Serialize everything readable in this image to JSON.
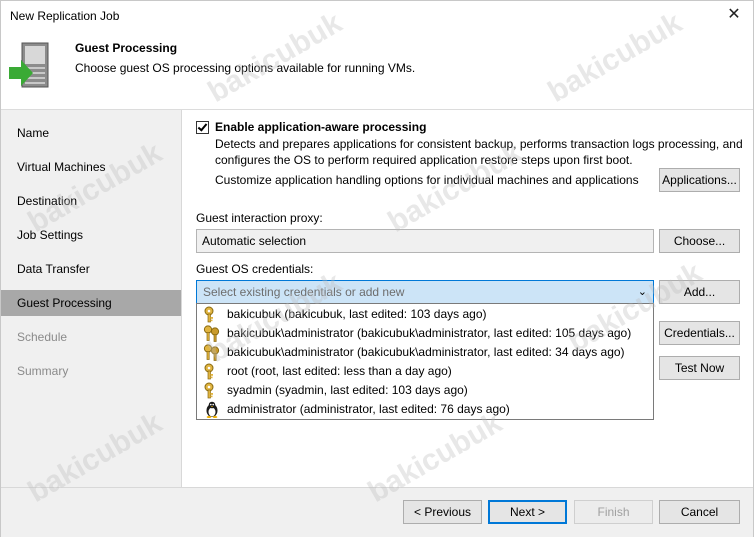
{
  "window": {
    "title": "New Replication Job",
    "close_glyph": "✕"
  },
  "header": {
    "title": "Guest Processing",
    "description": "Choose guest OS processing options available for running VMs.",
    "icon": "vm-arrow-icon"
  },
  "sidebar": {
    "items": [
      {
        "label": "Name",
        "state": "normal"
      },
      {
        "label": "Virtual Machines",
        "state": "normal"
      },
      {
        "label": "Destination",
        "state": "normal"
      },
      {
        "label": "Job Settings",
        "state": "normal"
      },
      {
        "label": "Data Transfer",
        "state": "normal"
      },
      {
        "label": "Guest Processing",
        "state": "active"
      },
      {
        "label": "Schedule",
        "state": "disabled"
      },
      {
        "label": "Summary",
        "state": "disabled"
      }
    ]
  },
  "main": {
    "app_aware": {
      "checked": true,
      "label": "Enable application-aware processing",
      "description_line1": "Detects and prepares applications for consistent backup, performs transaction logs processing, and",
      "description_line2": "configures the OS to perform required application restore steps upon first boot.",
      "customize_text": "Customize application handling options for individual machines and applications",
      "applications_button": "Applications..."
    },
    "proxy": {
      "label": "Guest interaction proxy:",
      "value": "Automatic selection",
      "choose_button": "Choose..."
    },
    "credentials": {
      "label": "Guest OS credentials:",
      "placeholder": "Select existing credentials or add new",
      "add_button": "Add...",
      "credentials_button": "Credentials...",
      "test_button": "Test Now",
      "options": [
        {
          "text": "bakicubuk (bakicubuk, last edited: 103 days ago)",
          "icon": "key-icon"
        },
        {
          "text": "bakicubuk\\administrator (bakicubuk\\administrator, last edited: 105 days ago)",
          "icon": "keys-icon"
        },
        {
          "text": "bakicubuk\\administrator (bakicubuk\\administrator, last edited: 34 days ago)",
          "icon": "keys-icon"
        },
        {
          "text": "root (root, last edited: less than a day ago)",
          "icon": "key-icon"
        },
        {
          "text": "syadmin (syadmin, last edited: 103 days ago)",
          "icon": "key-icon"
        },
        {
          "text": "administrator (administrator, last edited: 76 days ago)",
          "icon": "linux-penguin-icon"
        }
      ]
    }
  },
  "footer": {
    "previous": "< Previous",
    "next": "Next >",
    "finish": "Finish",
    "cancel": "Cancel"
  },
  "watermark": "bakicubuk",
  "colors": {
    "accent": "#0078d7",
    "sidebar_active": "#a8a8a8",
    "sidebar_bg": "#f0f0f0",
    "icon_green": "#3aaa35"
  }
}
